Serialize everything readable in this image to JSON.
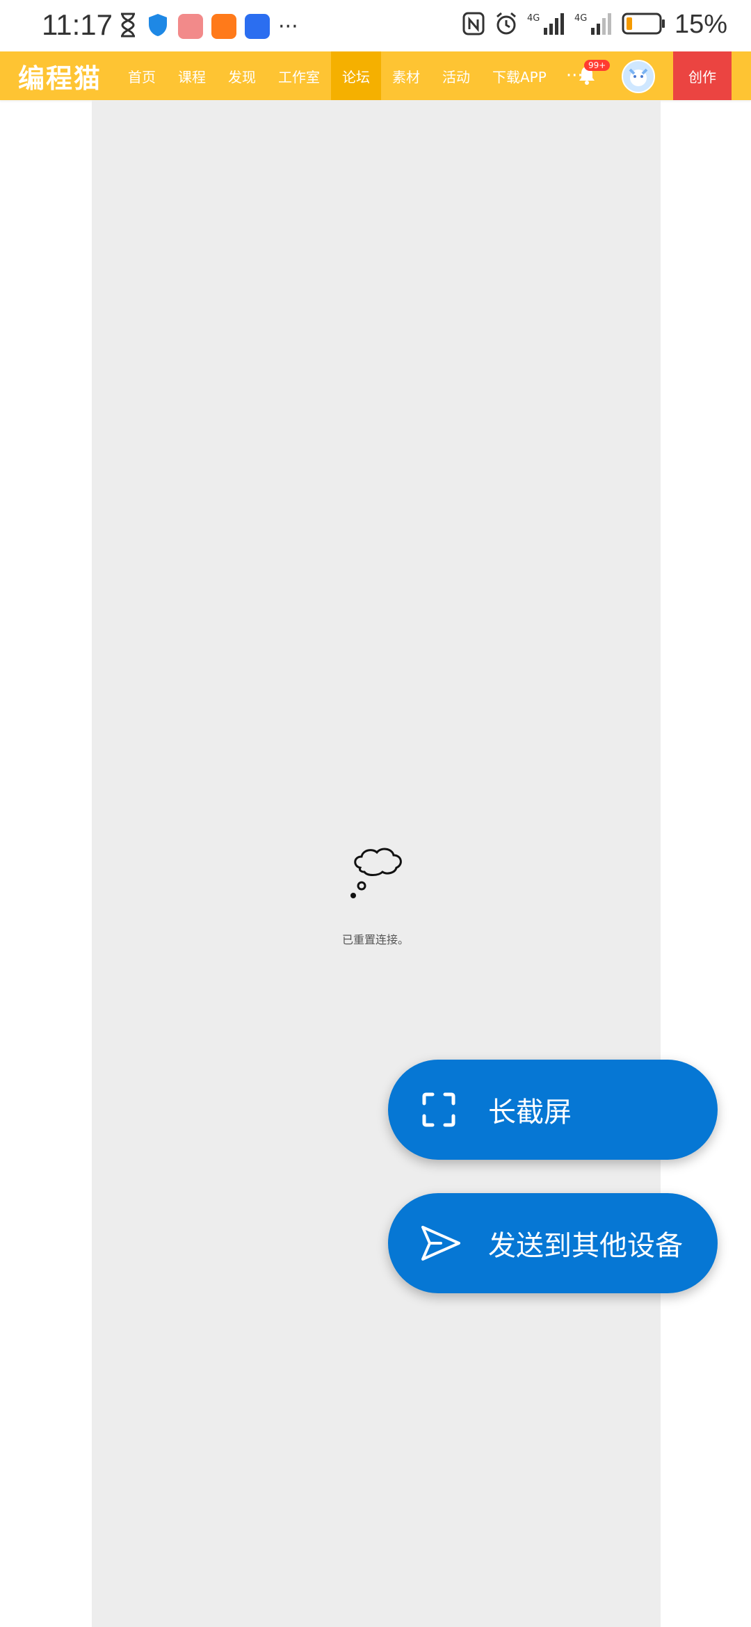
{
  "status_bar": {
    "time": "11:17",
    "battery_percent": "15%",
    "signal_text": "4G"
  },
  "nav": {
    "brand": "编程猫",
    "items": [
      {
        "label": "首页",
        "active": false
      },
      {
        "label": "课程",
        "active": false
      },
      {
        "label": "发现",
        "active": false
      },
      {
        "label": "工作室",
        "active": false
      },
      {
        "label": "论坛",
        "active": true
      },
      {
        "label": "素材",
        "active": false
      },
      {
        "label": "活动",
        "active": false
      },
      {
        "label": "下载APP",
        "active": false
      }
    ],
    "more": "···",
    "notification_badge": "99+",
    "create_label": "创作",
    "colors": {
      "nav_bg": "#fec433",
      "active_bg": "#f5b000",
      "create_bg": "#eb4441"
    }
  },
  "content": {
    "message": "已重置连接。"
  },
  "overlay": {
    "long_screenshot_label": "长截屏",
    "send_to_device_label": "发送到其他设备",
    "colors": {
      "pill_bg": "#0677d4"
    }
  }
}
